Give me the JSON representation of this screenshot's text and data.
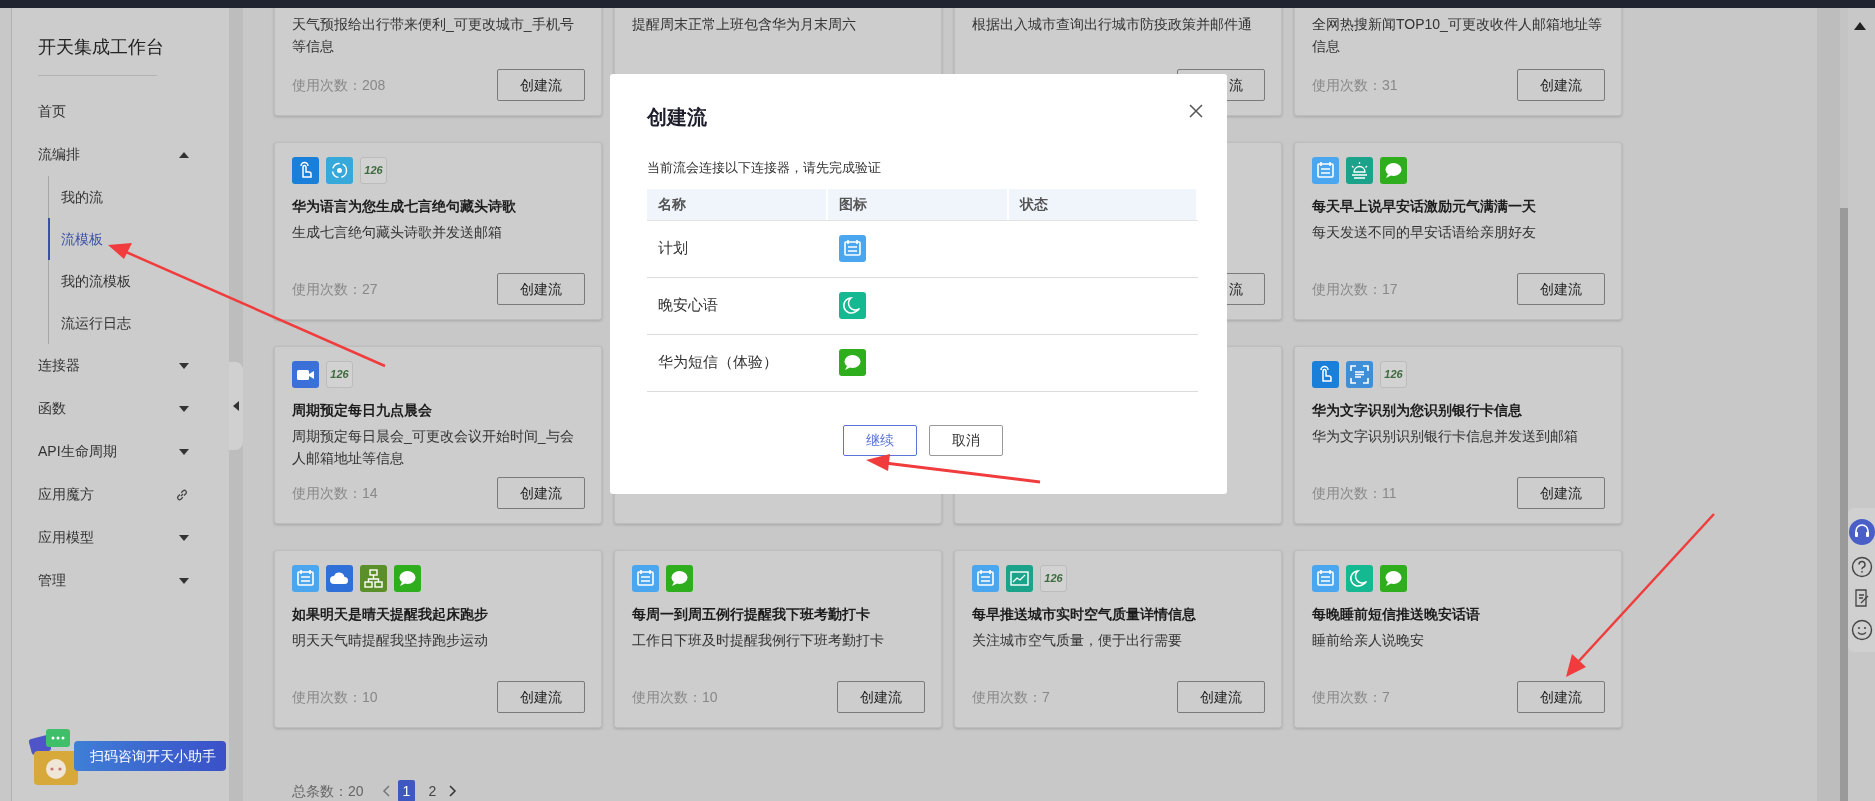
{
  "sidebar": {
    "title": "开天集成工作台",
    "items": [
      {
        "label": "首页",
        "kind": "plain",
        "selected": false
      },
      {
        "label": "流编排",
        "kind": "group",
        "expanded": true,
        "selected": false,
        "children": [
          {
            "label": "我的流",
            "selected": false
          },
          {
            "label": "流模板",
            "selected": true
          },
          {
            "label": "我的流模板",
            "selected": false
          },
          {
            "label": "流运行日志",
            "selected": false
          }
        ]
      },
      {
        "label": "连接器",
        "kind": "group",
        "expanded": false,
        "selected": false
      },
      {
        "label": "函数",
        "kind": "group",
        "expanded": false,
        "selected": false
      },
      {
        "label": "API生命周期",
        "kind": "group",
        "expanded": false,
        "selected": false
      },
      {
        "label": "应用魔方",
        "kind": "external",
        "selected": false
      },
      {
        "label": "应用模型",
        "kind": "group",
        "expanded": false,
        "selected": false
      },
      {
        "label": "管理",
        "kind": "group",
        "expanded": false,
        "selected": false
      }
    ],
    "helper": "扫码咨询开天小助手"
  },
  "template_rows": [
    {
      "cards": [
        {
          "description": "天气预报给出行带来便利_可更改城市_手机号等信息",
          "uses": "使用次数：208",
          "button": "创建流"
        },
        {
          "description": "提醒周末正常上班包含华为月末周六"
        },
        {
          "kind": "partial",
          "description": "根据出入城市查询出行城市防疫政策并邮件通",
          "button": "流"
        },
        {
          "description": "全网热搜新闻TOP10_可更改收件人邮箱地址等信息",
          "uses": "使用次数：31",
          "button": "创建流"
        }
      ]
    },
    {
      "cards": [
        {
          "icons": [
            {
              "kind": "touch"
            },
            {
              "kind": "ai"
            },
            {
              "kind": "mail126",
              "label": "126"
            }
          ],
          "title": "华为语言为您生成七言绝句藏头诗歌",
          "description": "生成七言绝句藏头诗歌并发送邮箱",
          "uses": "使用次数：27",
          "button": "创建流"
        },
        {
          "kind": "hidden"
        },
        {
          "kind": "partial",
          "button": "流"
        },
        {
          "icons": [
            {
              "kind": "calendar"
            },
            {
              "kind": "sun"
            },
            {
              "kind": "sms"
            }
          ],
          "title": "每天早上说早安话激励元气满满一天",
          "description": "每天发送不同的早安话语给亲朋好友",
          "uses": "使用次数：17",
          "button": "创建流"
        }
      ]
    },
    {
      "cards": [
        {
          "icons": [
            {
              "kind": "video"
            },
            {
              "kind": "mail126",
              "label": "126"
            }
          ],
          "title": "周期预定每日九点晨会",
          "description": "周期预定每日晨会_可更改会议开始时间_与会人邮箱地址等信息",
          "uses": "使用次数：14",
          "button": "创建流"
        },
        {
          "kind": "covered"
        },
        {
          "kind": "covered"
        },
        {
          "icons": [
            {
              "kind": "touch"
            },
            {
              "kind": "scan"
            },
            {
              "kind": "mail126",
              "label": "126"
            }
          ],
          "title": "华为文字识别为您识别银行卡信息",
          "description": "华为文字识别识别银行卡信息并发送到邮箱",
          "uses": "使用次数：11",
          "button": "创建流"
        }
      ]
    },
    {
      "cards": [
        {
          "icons": [
            {
              "kind": "calendar"
            },
            {
              "kind": "cloud"
            },
            {
              "kind": "org"
            },
            {
              "kind": "sms"
            }
          ],
          "title": "如果明天是晴天提醒我起床跑步",
          "description": "明天天气晴提醒我坚持跑步运动",
          "uses": "使用次数：10",
          "button": "创建流"
        },
        {
          "icons": [
            {
              "kind": "calendar"
            },
            {
              "kind": "sms"
            }
          ],
          "title": "每周一到周五例行提醒我下班考勤打卡",
          "description": "工作日下班及时提醒我例行下班考勤打卡",
          "uses": "使用次数：10",
          "button": "创建流"
        },
        {
          "icons": [
            {
              "kind": "calendar"
            },
            {
              "kind": "air"
            },
            {
              "kind": "mail126",
              "label": "126"
            }
          ],
          "title": "每早推送城市实时空气质量详情信息",
          "description": "关注城市空气质量，便于出行需要",
          "uses": "使用次数：7",
          "button": "创建流"
        },
        {
          "icons": [
            {
              "kind": "calendar"
            },
            {
              "kind": "moon"
            },
            {
              "kind": "sms"
            }
          ],
          "title": "每晚睡前短信推送晚安话语",
          "description": "睡前给亲人说晚安",
          "uses": "使用次数：7",
          "button": "创建流"
        }
      ]
    }
  ],
  "pagination": {
    "total": "总条数：20",
    "pages": [
      {
        "label": "1",
        "selected": true
      },
      {
        "label": "2",
        "selected": false
      }
    ]
  },
  "modal": {
    "title": "创建流",
    "message": "当前流会连接以下连接器，请先完成验证",
    "columns": [
      "名称",
      "图标",
      "状态"
    ],
    "rows": [
      {
        "name": "计划",
        "kind": "calendar"
      },
      {
        "name": "晚安心语",
        "kind": "moon"
      },
      {
        "name": "华为短信（体验）",
        "kind": "sms"
      }
    ],
    "buttons": [
      {
        "label": "继续",
        "kind": "primary"
      },
      {
        "label": "取消",
        "kind": "default"
      }
    ]
  }
}
